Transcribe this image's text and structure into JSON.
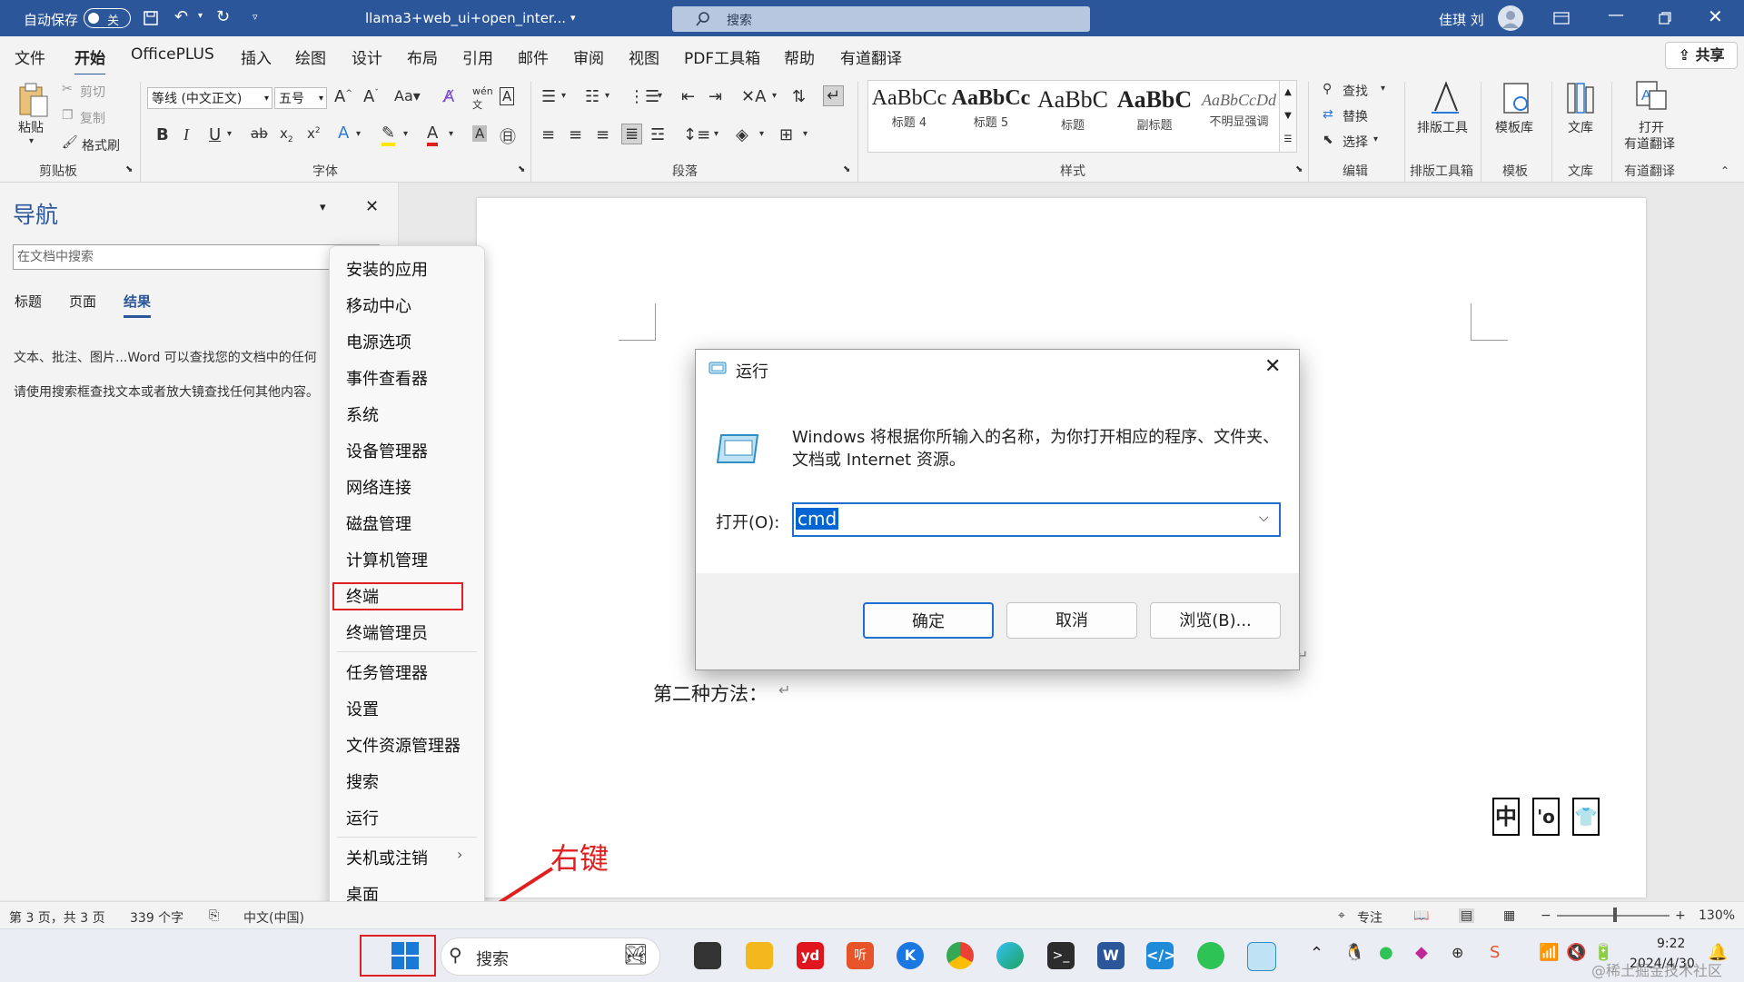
{
  "titlebar": {
    "autosave_label": "自动保存",
    "autosave_state": "关",
    "doc_title": "llama3+web_ui+open_inter...",
    "search_placeholder": "搜索",
    "user_name": "佳琪 刘"
  },
  "menubar": {
    "items": [
      "文件",
      "开始",
      "OfficePLUS",
      "插入",
      "绘图",
      "设计",
      "布局",
      "引用",
      "邮件",
      "审阅",
      "视图",
      "PDF工具箱",
      "帮助",
      "有道翻译"
    ],
    "active": "开始",
    "share_label": "共享"
  },
  "ribbon": {
    "clipboard": {
      "paste": "粘贴",
      "cut": "剪切",
      "copy": "复制",
      "format_painter": "格式刷",
      "group": "剪贴板"
    },
    "font": {
      "font_name": "等线 (中文正文)",
      "font_size": "五号",
      "group": "字体"
    },
    "paragraph": {
      "group": "段落"
    },
    "styles": {
      "items": [
        {
          "sample": "AaBbCc",
          "name": "标题 4"
        },
        {
          "sample": "AaBbCc",
          "name": "标题 5"
        },
        {
          "sample": "AaBbC",
          "name": "标题"
        },
        {
          "sample": "AaBbC",
          "name": "副标题"
        },
        {
          "sample": "AaBbCcDd",
          "name": "不明显强调"
        }
      ],
      "group": "样式"
    },
    "editing": {
      "find": "查找",
      "replace": "替换",
      "select": "选择",
      "group": "编辑"
    },
    "layout_tools": {
      "label": "排版工具",
      "group": "排版工具箱"
    },
    "templates": {
      "label": "模板库",
      "group": "模板"
    },
    "library": {
      "label": "文库",
      "group": "文库"
    },
    "youdao": {
      "label1": "打开",
      "label2": "有道翻译",
      "group": "有道翻译"
    }
  },
  "nav": {
    "title": "导航",
    "search_placeholder": "在文档中搜索",
    "tabs": [
      "标题",
      "页面",
      "结果"
    ],
    "active_tab": "结果",
    "hint1": "文本、批注、图片...Word 可以查找您的文档中的任何",
    "hint2": "请使用搜索框查找文本或者放大镜查找任何其他内容。"
  },
  "context_menu": {
    "items": [
      "安装的应用",
      "移动中心",
      "电源选项",
      "事件查看器",
      "系统",
      "设备管理器",
      "网络连接",
      "磁盘管理",
      "计算机管理",
      "终端",
      "终端管理员",
      "任务管理器",
      "设置",
      "文件资源管理器",
      "搜索",
      "运行",
      "关机或注销",
      "桌面"
    ],
    "highlighted": "终端"
  },
  "run_dialog": {
    "title": "运行",
    "description": "Windows 将根据你所输入的名称，为你打开相应的程序、文件夹、文档或 Internet 资源。",
    "open_label": "打开(O):",
    "input_value": "cmd",
    "ok": "确定",
    "cancel": "取消",
    "browse": "浏览(B)..."
  },
  "document": {
    "text": "第二种方法：",
    "ime_chars": [
      "中",
      "'o",
      "👕"
    ]
  },
  "annotation": {
    "right_click": "右键"
  },
  "statusbar": {
    "page": "第 3 页，共 3 页",
    "words": "339 个字",
    "lang": "中文(中国)",
    "focus": "专注",
    "zoom": "130%"
  },
  "taskbar": {
    "search": "搜索",
    "time": "9:22",
    "date": "2024/4/30",
    "watermark": "@稀土掘金技术社区"
  },
  "colors": {
    "word_blue": "#2b579a",
    "highlight_red": "#e02020"
  }
}
